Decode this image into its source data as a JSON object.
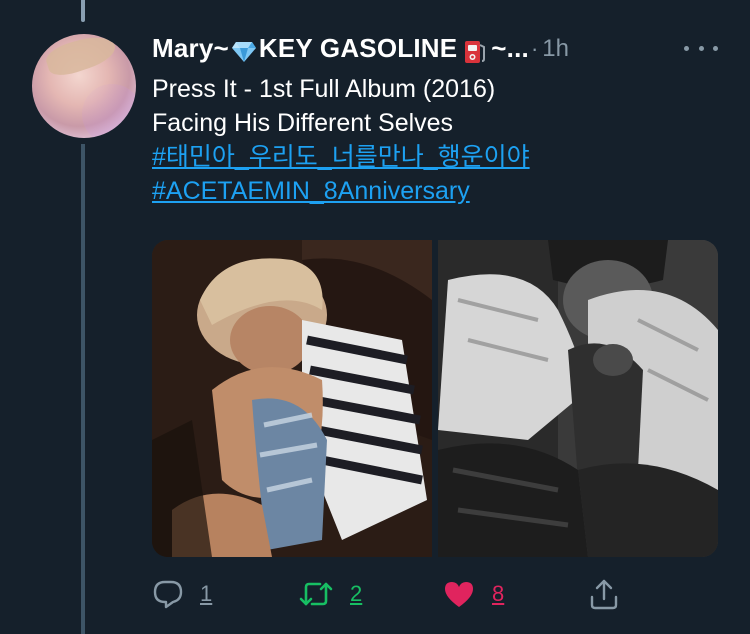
{
  "tweet": {
    "display_name_prefix": "Mary~",
    "display_name_middle": "KEY GASOLINE",
    "display_name_suffix": "~...",
    "separator": "·",
    "timestamp": "1h",
    "text_lines": [
      "Press It - 1st Full Album (2016)",
      "Facing His Different Selves"
    ],
    "hashtags": [
      "#태민아_우리도_너를만나_행운이야",
      "#ACETAEMIN_8Anniversary"
    ]
  },
  "actions": {
    "reply_count": "1",
    "retweet_count": "2",
    "like_count": "8"
  },
  "icons": {
    "avatar": "avatar-image",
    "diamond": "gem-emoji-icon",
    "fuel": "fuel-pump-emoji-icon",
    "more": "more-options-icon",
    "reply": "reply-icon",
    "retweet": "retweet-icon",
    "like": "heart-icon",
    "share": "share-icon"
  },
  "colors": {
    "background": "#15202b",
    "text": "#ffffff",
    "secondary_text": "#8899a6",
    "link": "#1da1f2",
    "retweet": "#17bf63",
    "like": "#e0245e"
  }
}
